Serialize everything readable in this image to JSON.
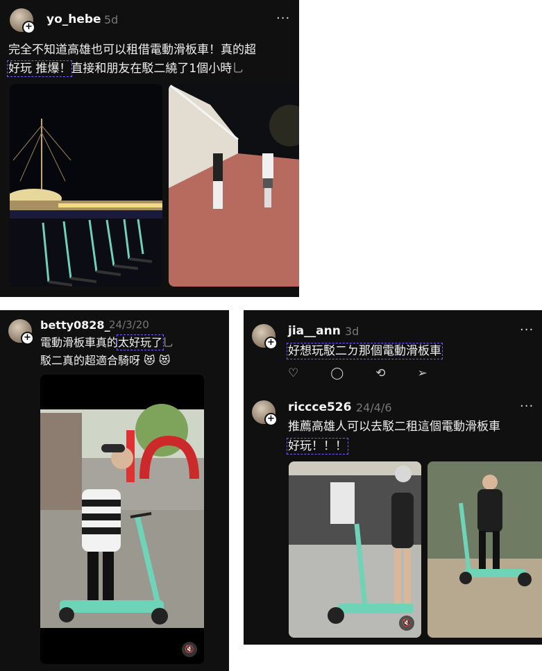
{
  "post1": {
    "username": "yo_hebe",
    "time": "5d",
    "more": "···",
    "line1": "完全不知道高雄也可以租借電動滑板車！真的超",
    "line2_hl": "好玩 推爆！",
    "line2_rest": "直接和朋友在駁二繞了1個小時",
    "squiggle": "乚"
  },
  "post2": {
    "username": "betty0828_",
    "time": "24/3/20",
    "line1_pre": "電動滑板車真的",
    "line1_hl": "太好玩了",
    "squiggle": "乚",
    "line2": "駁二真的超適合騎呀",
    "emoji": "😻 😻",
    "mute": "🔇"
  },
  "post3": {
    "username": "jia__ann",
    "time": "3d",
    "more": "···",
    "text_hl": "好想玩駁二ㄉ那個電動滑板車",
    "actions": [
      "♡",
      "◯",
      "⟲",
      "➢"
    ]
  },
  "post4": {
    "username": "riccce526",
    "time": "24/4/6",
    "more": "···",
    "line1": "推薦高雄人可以去駁二租這個電動滑板車",
    "line2_hl": "好玩！！！",
    "mute": "🔇"
  },
  "colors": {
    "panel": "#101010",
    "highlight": "#7a5cff",
    "scooter_teal": "#6fd3b8"
  }
}
